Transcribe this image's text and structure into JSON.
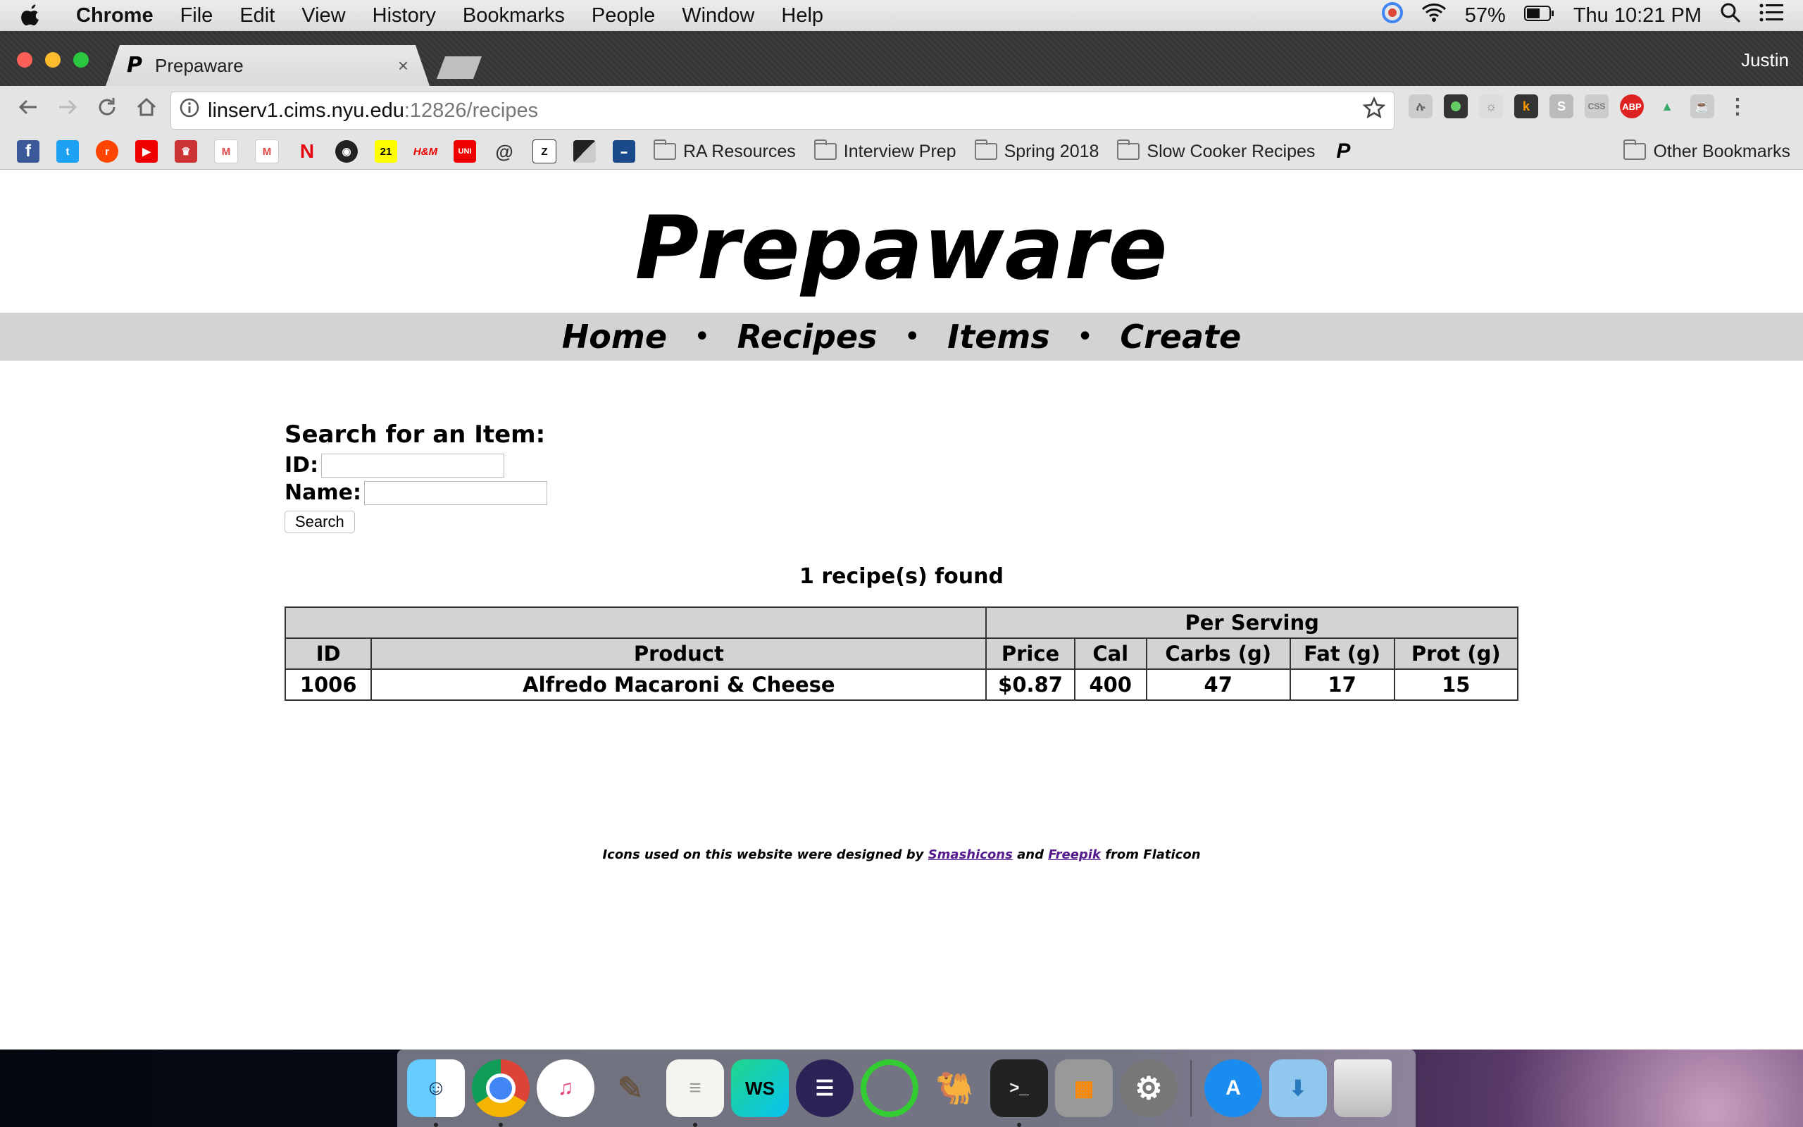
{
  "menubar": {
    "app": "Chrome",
    "items": [
      "File",
      "Edit",
      "View",
      "History",
      "Bookmarks",
      "People",
      "Window",
      "Help"
    ],
    "battery": "57%",
    "clock": "Thu 10:21 PM"
  },
  "browser": {
    "tab_title": "Prepaware",
    "tab_close": "×",
    "profile": "Justin",
    "url_host": "linserv1.cims.nyu.edu",
    "url_path": ":12826/recipes",
    "bookmark_folders": [
      "RA Resources",
      "Interview Prep",
      "Spring 2018",
      "Slow Cooker Recipes"
    ],
    "other_bookmarks": "Other Bookmarks"
  },
  "site": {
    "title": "Prepaware",
    "nav": [
      "Home",
      "Recipes",
      "Items",
      "Create"
    ],
    "nav_separator": "•"
  },
  "search": {
    "heading": "Search for an Item:",
    "id_label": "ID:",
    "name_label": "Name:",
    "id_value": "",
    "name_value": "",
    "button": "Search"
  },
  "results": {
    "count_text": "1 recipe(s) found",
    "group_header": "Per Serving",
    "columns": [
      "ID",
      "Product",
      "Price",
      "Cal",
      "Carbs (g)",
      "Fat (g)",
      "Prot (g)"
    ],
    "rows": [
      [
        "1006",
        "Alfredo Macaroni & Cheese",
        "$0.87",
        "400",
        "47",
        "17",
        "15"
      ]
    ]
  },
  "footer": {
    "prefix": "Icons used on this website were designed by",
    "link1": "Smashicons",
    "and": "and",
    "link2": "Freepik",
    "suffix": "from Flaticon"
  },
  "colors": {
    "nav_bar": "#d3d3d3",
    "table_header": "#d3d3d3",
    "link_visited": "#551a8b"
  }
}
